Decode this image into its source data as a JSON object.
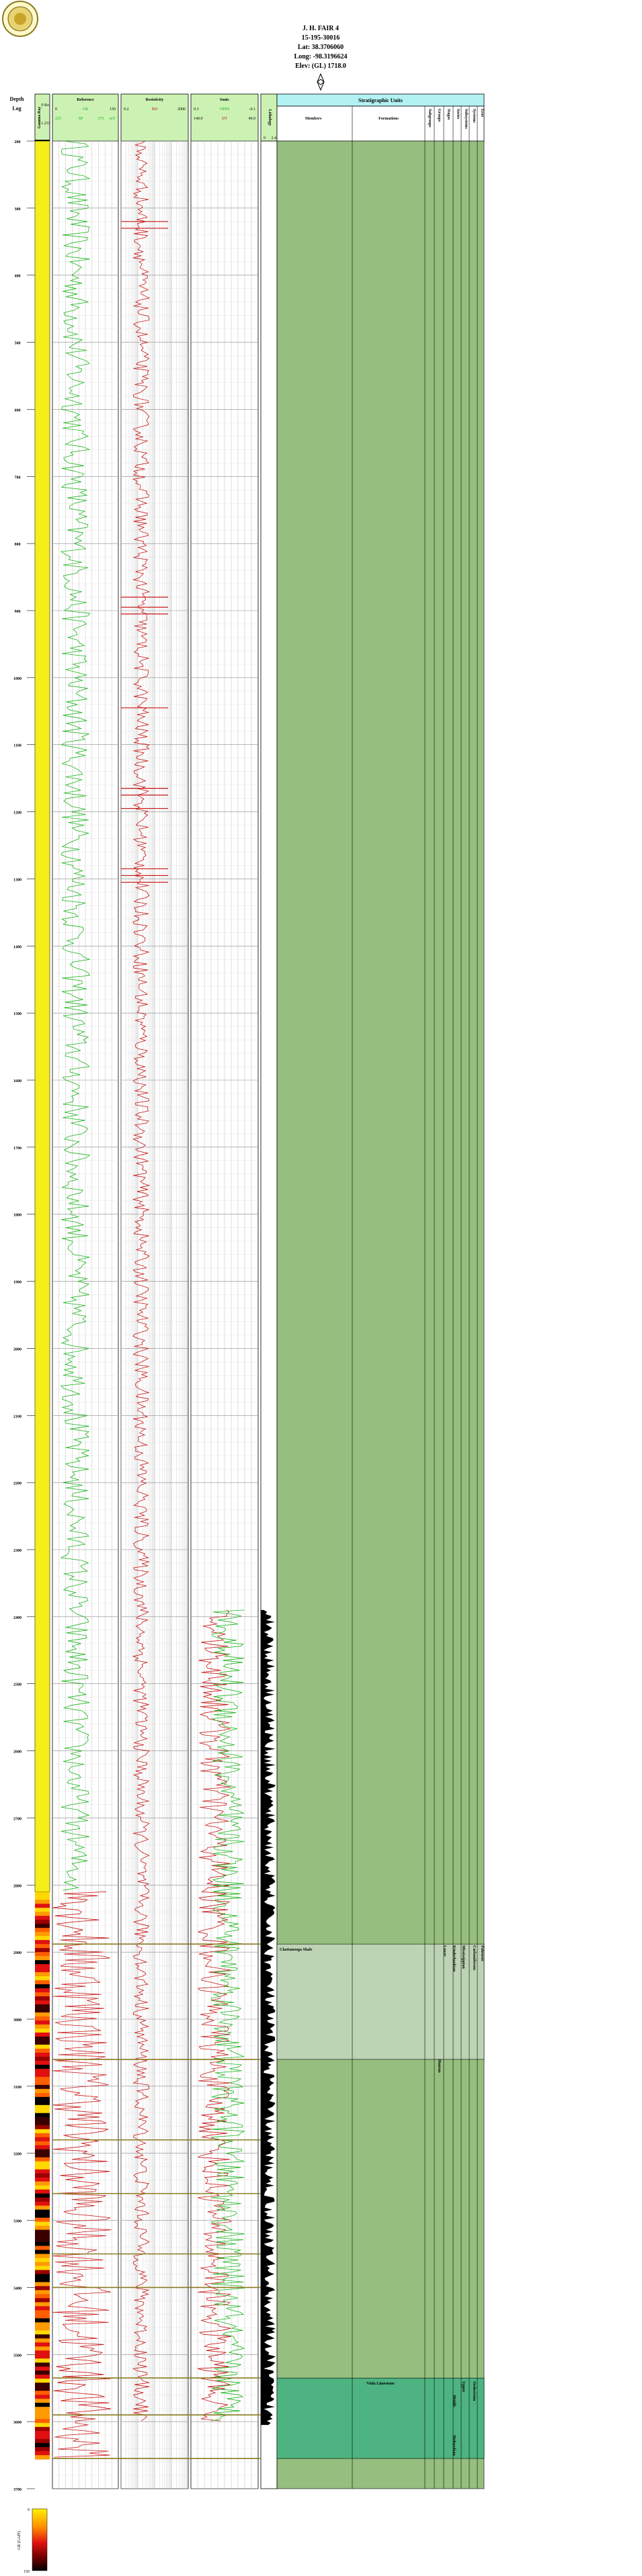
{
  "header": {
    "well_name": "J. H. FAIR 4",
    "api": "15-195-30016",
    "lat": "Lat: 38.3706060",
    "long": "Long: -98.3196624",
    "elev": "Elev: (GL) 1718.0"
  },
  "columns": {
    "depth_title": "Depth",
    "depth_sub": "Log",
    "gamma_ray_label": "Gamma Ray",
    "gamma_ray_top": "0 Ro.",
    "gamma_ray_bottom": "1.233",
    "reference": {
      "title": "Reference",
      "gr_left": "0",
      "gr_label": "GR",
      "gr_right": "150",
      "sp_left": "223",
      "sp_label": "SP",
      "sp_right": "373",
      "sp_unit": "mV"
    },
    "resistivity": {
      "title": "Resistivity",
      "left": "0.2",
      "label": "RD",
      "right": "2000"
    },
    "sonic": {
      "title": "Sonic",
      "nphi_left": "0.3",
      "nphi_label": "NPHI",
      "nphi_right": "-0.1",
      "dt_left": "140.0",
      "dt_label": "DT",
      "dt_right": "40.0"
    },
    "lithology": {
      "title": "Lithology",
      "left": "0",
      "right": "2.4"
    },
    "strat": {
      "title": "Stratigraphic Units",
      "members": "Members",
      "formations": "Formations",
      "subgroups": "Subgroups",
      "groups": "Groups",
      "stages": "Stages",
      "series": "Series",
      "subsystems": "Subsystems",
      "systems": "Systems",
      "eras": "Eras"
    }
  },
  "units": {
    "chattanooga": "Chattanooga Shale",
    "mississippian": "Mississippian",
    "lower": "Lower",
    "kinderhookian": "Kinderhookian",
    "carboniferous": "Carboniferous",
    "paleozoic": "Paleozoic",
    "hunton": "Hunton",
    "viola": "Viola Limestone",
    "ordovician": "Ordovician",
    "upper": "Upper",
    "middle": "Middle",
    "mohawkian": "Mohawkian"
  },
  "colorbar": {
    "label": "GR (GAPI)",
    "min": "0",
    "max": "150"
  },
  "colors": {
    "gr_curve": "#19b319",
    "resistivity_curve": "#c81414",
    "sonic_curve": "#c81414",
    "nphi_curve": "#19b319",
    "strat_default": "#96bf7f",
    "chattanooga": "#bdd4b4",
    "viola": "#4db380",
    "header_cyan": "#b3f2f2",
    "header_green": "#ccf2b3",
    "gamma_column": "#f5ee19"
  },
  "chart_data": {
    "type": "well_log",
    "depth_range": [
      200,
      3700
    ],
    "depth_ticks": [
      200,
      300,
      400,
      500,
      600,
      700,
      800,
      900,
      1000,
      1100,
      1200,
      1300,
      1400,
      1500,
      1600,
      1700,
      1800,
      1900,
      2000,
      2100,
      2200,
      2300,
      2400,
      2500,
      2600,
      2700,
      2800,
      2900,
      3000,
      3100,
      3200,
      3300,
      3400,
      3500,
      3600,
      3700
    ],
    "tracks": {
      "gr": {
        "range": [
          0,
          150
        ],
        "depth_range": [
          200,
          2810
        ]
      },
      "resistivity": {
        "range": [
          0.2,
          2000
        ],
        "scale": "log",
        "depth_range": [
          200,
          3600
        ]
      },
      "nphi": {
        "range": [
          0.3,
          -0.1
        ],
        "depth_range": [
          2390,
          3600
        ]
      },
      "dt": {
        "range": [
          140,
          40
        ],
        "depth_range": [
          2390,
          3600
        ]
      }
    },
    "formation_tops": [
      {
        "name": "Chattanooga Shale",
        "top": 2888,
        "base": 3060
      },
      {
        "name": "Viola Limestone",
        "top": 3535,
        "base": 3655
      }
    ],
    "marker_depths": [
      2888,
      3060,
      3180,
      3260,
      3350,
      3400,
      3535,
      3590,
      3655
    ]
  }
}
